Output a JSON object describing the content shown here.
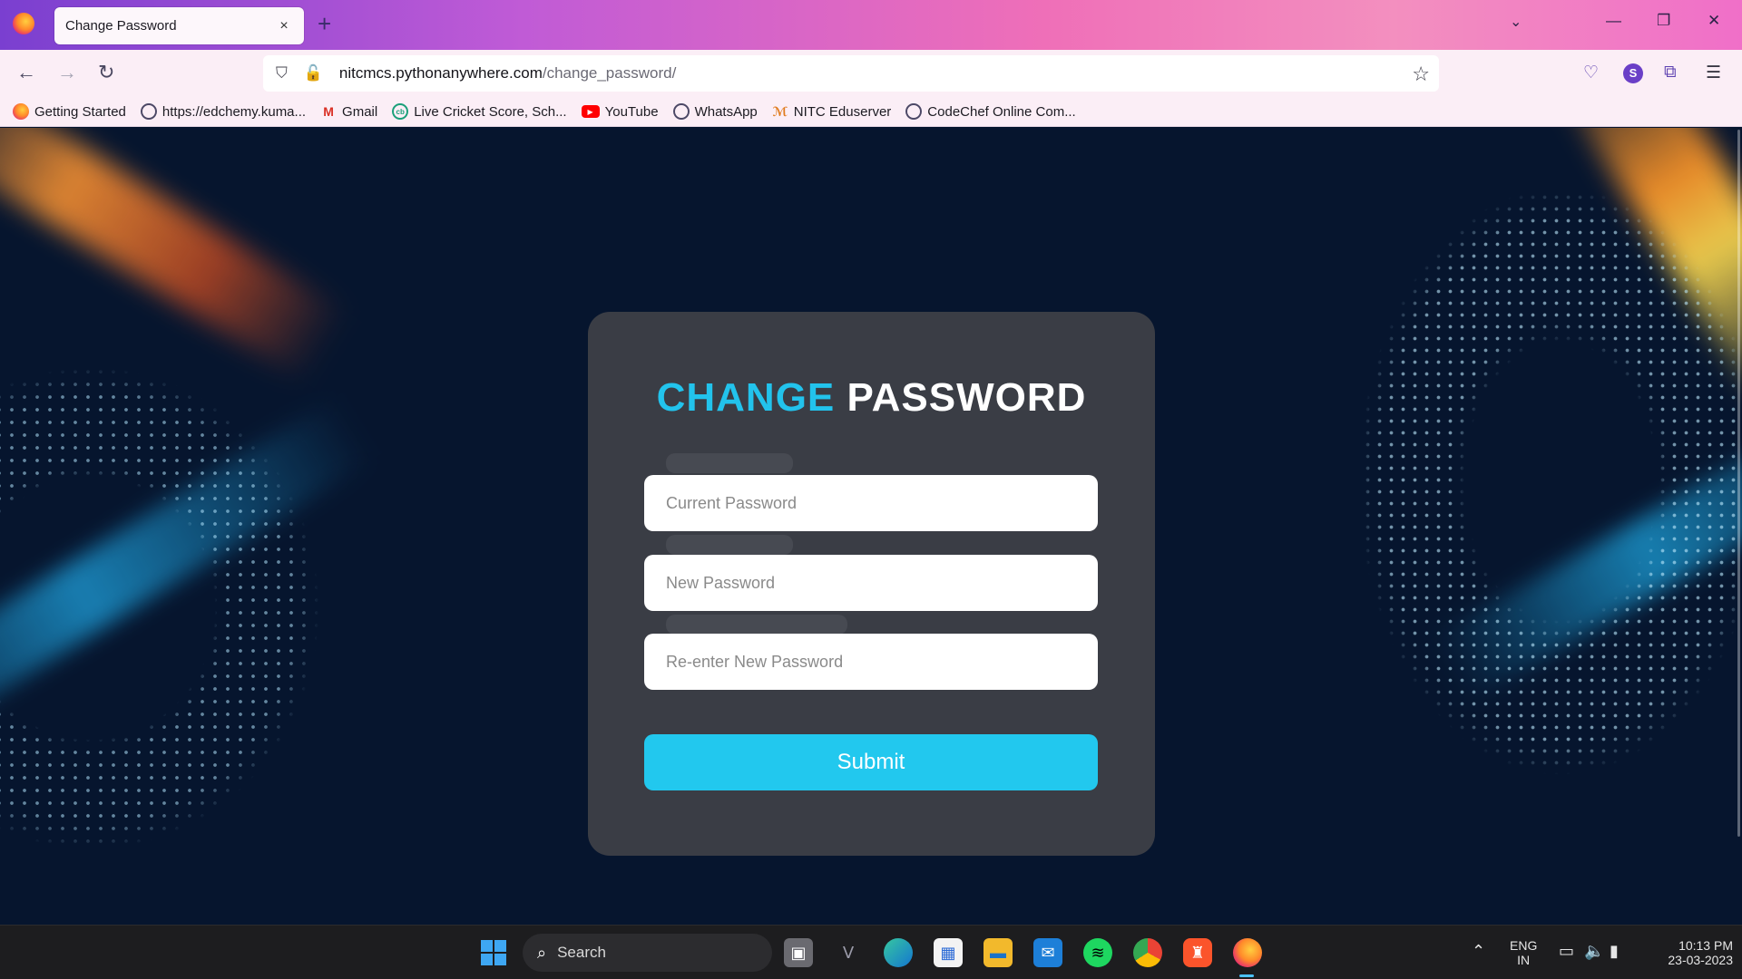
{
  "browser": {
    "tab_title": "Change Password",
    "tab_close": "×",
    "new_tab": "+",
    "url_host": "nitcmcs.pythonanywhere.com",
    "url_path": "/change_password/",
    "bookmarks": [
      {
        "label": "Getting Started",
        "icon": "firefox-icon"
      },
      {
        "label": "https://edchemy.kuma...",
        "icon": "globe-icon"
      },
      {
        "label": "Gmail",
        "icon": "gmail-icon"
      },
      {
        "label": "Live Cricket Score, Sch...",
        "icon": "cricbuzz-icon"
      },
      {
        "label": "YouTube",
        "icon": "youtube-icon"
      },
      {
        "label": "WhatsApp",
        "icon": "globe-icon"
      },
      {
        "label": "NITC Eduserver",
        "icon": "nitc-icon"
      },
      {
        "label": "CodeChef Online Com...",
        "icon": "globe-icon"
      }
    ],
    "profile_initial": "S"
  },
  "page": {
    "title_accent": "CHANGE",
    "title_main": "PASSWORD",
    "current_password_placeholder": "Current Password",
    "new_password_placeholder": "New Password",
    "reenter_password_placeholder": "Re-enter New Password",
    "submit_label": "Submit",
    "accent_color": "#22c3ec",
    "card_color": "#3a3d45"
  },
  "taskbar": {
    "search_label": "Search",
    "language_top": "ENG",
    "language_bottom": "IN",
    "time": "10:13 PM",
    "date": "23-03-2023"
  }
}
